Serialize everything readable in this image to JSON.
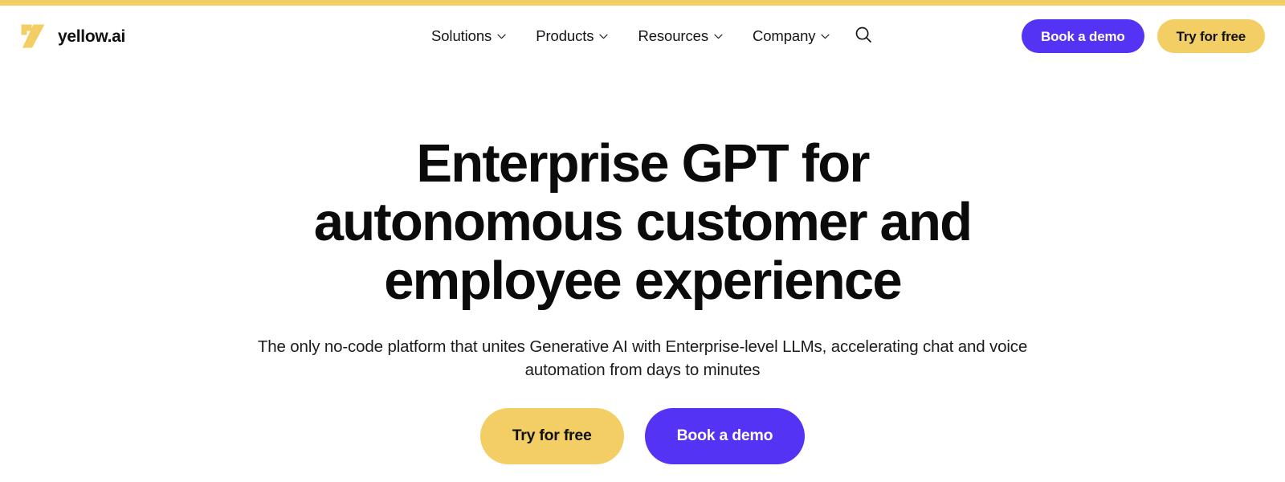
{
  "theme": {
    "accent_yellow": "#F2CE64",
    "accent_purple": "#5533F5",
    "text_dark": "#111111",
    "page_background": "#FFFFFF"
  },
  "top_strip": {
    "color": "#F2CE64"
  },
  "header": {
    "brand": {
      "logo_icon": "yellow-ai-logo-icon",
      "name": "yellow.ai"
    },
    "nav": [
      {
        "label": "Solutions",
        "icon": "chevron-down-icon"
      },
      {
        "label": "Products",
        "icon": "chevron-down-icon"
      },
      {
        "label": "Resources",
        "icon": "chevron-down-icon"
      },
      {
        "label": "Company",
        "icon": "chevron-down-icon"
      }
    ],
    "search": {
      "icon": "search-icon"
    },
    "actions": {
      "book_demo": "Book a demo",
      "try_free": "Try for free"
    }
  },
  "hero": {
    "title_lines": [
      "Enterprise GPT for",
      "autonomous customer and",
      "employee experience"
    ],
    "title": "Enterprise GPT for autonomous customer and employee experience",
    "subtitle": "The only no-code platform that unites Generative AI with Enterprise-level LLMs, accelerating chat and voice automation from days to minutes",
    "actions": {
      "try_free": "Try for free",
      "book_demo": "Book a demo"
    }
  }
}
